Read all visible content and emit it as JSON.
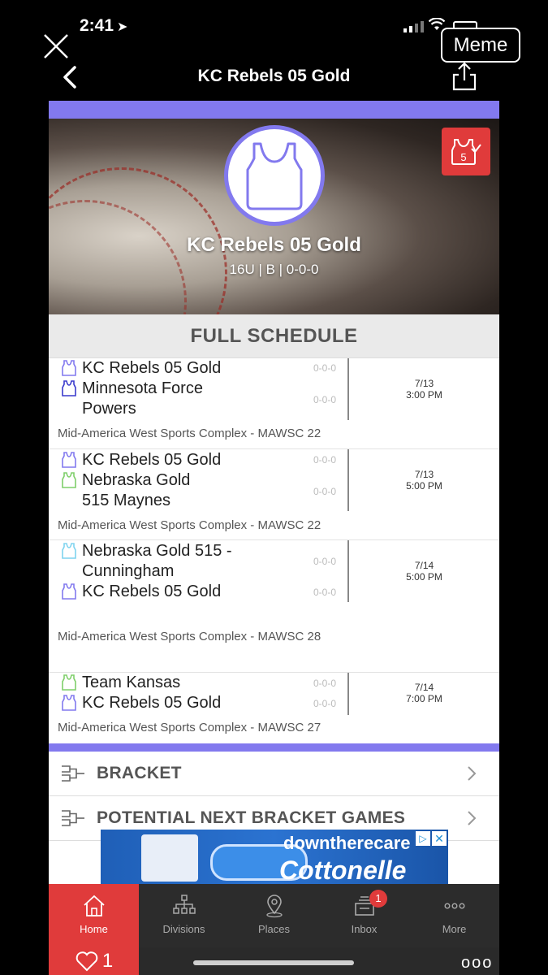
{
  "status_bar": {
    "time": "2:41",
    "location_arrow": "➤"
  },
  "overlay": {
    "meme_label": "Meme"
  },
  "nav": {
    "title": "KC Rebels 05 Gold"
  },
  "team": {
    "name": "KC Rebels 05 Gold",
    "subtitle": "16U | B | 0-0-0",
    "favorite_badge": "5"
  },
  "schedule": {
    "heading": "FULL SCHEDULE",
    "games": [
      {
        "teams": [
          {
            "name": "KC Rebels 05 Gold",
            "record": "0-0-0",
            "jersey_color": "#8279ee"
          },
          {
            "name": "Minnesota Force Powers",
            "record": "0-0-0",
            "jersey_color": "#3a3acc"
          }
        ],
        "date": "7/13",
        "time": "3:00 PM",
        "venue": "Mid-America West Sports Complex - MAWSC 22"
      },
      {
        "teams": [
          {
            "name": "KC Rebels 05 Gold",
            "record": "0-0-0",
            "jersey_color": "#8279ee"
          },
          {
            "name": "Nebraska Gold 515 Maynes",
            "record": "0-0-0",
            "jersey_color": "#7fcf6a"
          }
        ],
        "date": "7/13",
        "time": "5:00 PM",
        "venue": "Mid-America West Sports Complex - MAWSC 22"
      },
      {
        "teams": [
          {
            "name": "Nebraska Gold 515 - Cunningham",
            "record": "0-0-0",
            "jersey_color": "#7fd4ef"
          },
          {
            "name": "KC Rebels 05 Gold",
            "record": "0-0-0",
            "jersey_color": "#8279ee"
          }
        ],
        "date": "7/14",
        "time": "5:00 PM",
        "venue": "Mid-America West Sports Complex - MAWSC 28"
      },
      {
        "teams": [
          {
            "name": "Team Kansas",
            "record": "0-0-0",
            "jersey_color": "#7fcf6a"
          },
          {
            "name": "KC Rebels 05 Gold",
            "record": "0-0-0",
            "jersey_color": "#8279ee"
          }
        ],
        "date": "7/14",
        "time": "7:00 PM",
        "venue": "Mid-America West Sports Complex - MAWSC 27"
      }
    ]
  },
  "links": {
    "bracket": "BRACKET",
    "potential": "POTENTIAL NEXT BRACKET GAMES"
  },
  "ad": {
    "tagline": "downtherecare",
    "brand": "Cottonelle",
    "choices": "▷",
    "close": "✕"
  },
  "tabs": [
    {
      "label": "Home",
      "icon": "home-icon"
    },
    {
      "label": "Divisions",
      "icon": "divisions-icon"
    },
    {
      "label": "Places",
      "icon": "places-icon"
    },
    {
      "label": "Inbox",
      "icon": "inbox-icon",
      "badge": "1"
    },
    {
      "label": "More",
      "icon": "more-icon"
    }
  ],
  "footer": {
    "like_count": "1",
    "more_dots": "ooo"
  },
  "colors": {
    "accent_purple": "#8279ee",
    "accent_red": "#e03b3b",
    "tab_bg": "#2c2c2c"
  }
}
